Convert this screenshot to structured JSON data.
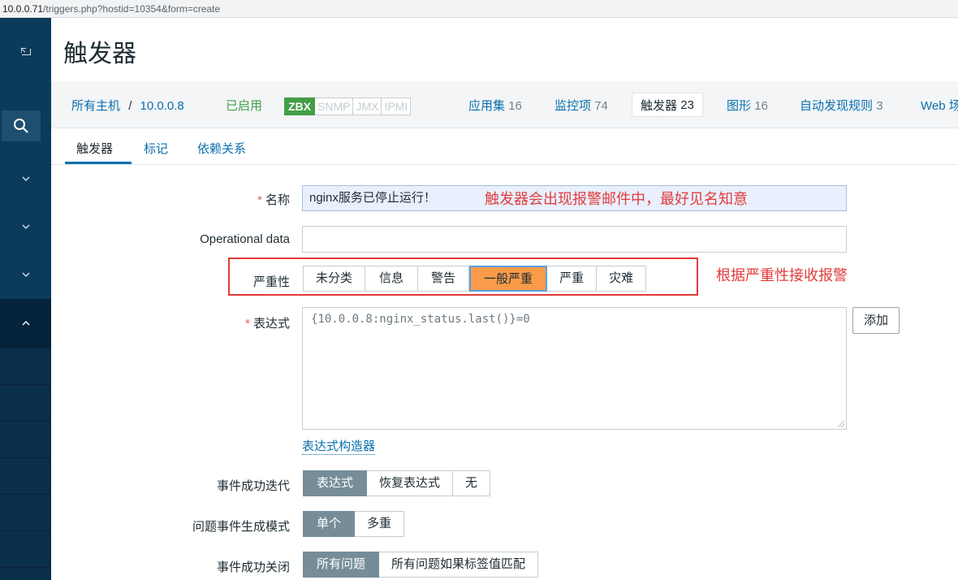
{
  "browser": {
    "url_host": "10.0.0.71",
    "url_path": "/triggers.php?hostid=10354&form=create"
  },
  "sidebar": {
    "collapse_icon": "collapse-icon",
    "search_icon": "search-icon",
    "chevrons": [
      "chevron-down-icon",
      "chevron-down-icon",
      "chevron-down-icon",
      "chevron-up-icon"
    ]
  },
  "header": {
    "title": "触发器"
  },
  "host_nav": {
    "all_hosts": "所有主机",
    "separator": "/",
    "host": "10.0.0.8",
    "status": "已启用",
    "protocols": [
      "ZBX",
      "SNMP",
      "JMX",
      "IPMI"
    ],
    "items": [
      {
        "label": "应用集",
        "count": "16"
      },
      {
        "label": "监控项",
        "count": "74"
      },
      {
        "label": "触发器",
        "count": "23"
      },
      {
        "label": "图形",
        "count": "16"
      },
      {
        "label": "自动发现规则",
        "count": "3"
      },
      {
        "label": "Web 场",
        "count": ""
      }
    ]
  },
  "tabs": [
    "触发器",
    "标记",
    "依赖关系"
  ],
  "form": {
    "name_label": "名称",
    "name_value": "nginx服务已停止运行！",
    "name_annotation": "触发器会出现报警邮件中，最好见名知意",
    "opdata_label": "Operational data",
    "opdata_value": "",
    "severity_label": "严重性",
    "severity_options": [
      "未分类",
      "信息",
      "警告",
      "一般严重",
      "严重",
      "灾难"
    ],
    "severity_selected": "一般严重",
    "severity_annotation": "根据严重性接收报警",
    "expression_label": "表达式",
    "expression_value": "{10.0.0.8:nginx_status.last()}=0",
    "add_button": "添加",
    "expression_builder": "表达式构造器",
    "ok_event_label": "事件成功迭代",
    "ok_event_options": [
      "表达式",
      "恢复表达式",
      "无"
    ],
    "ok_event_selected": "表达式",
    "problem_mode_label": "问题事件生成模式",
    "problem_mode_options": [
      "单个",
      "多重"
    ],
    "problem_mode_selected": "单个",
    "ok_close_label": "事件成功关闭",
    "ok_close_options": [
      "所有问题",
      "所有问题如果标签值匹配"
    ],
    "ok_close_selected": "所有问题"
  },
  "colors": {
    "sidebar": "#0c3a5a",
    "link": "#0b6fad",
    "enabled": "#429e47",
    "severity_selected": "#f99b49",
    "annotation": "#e33b3b",
    "segment_selected": "#768d99"
  }
}
